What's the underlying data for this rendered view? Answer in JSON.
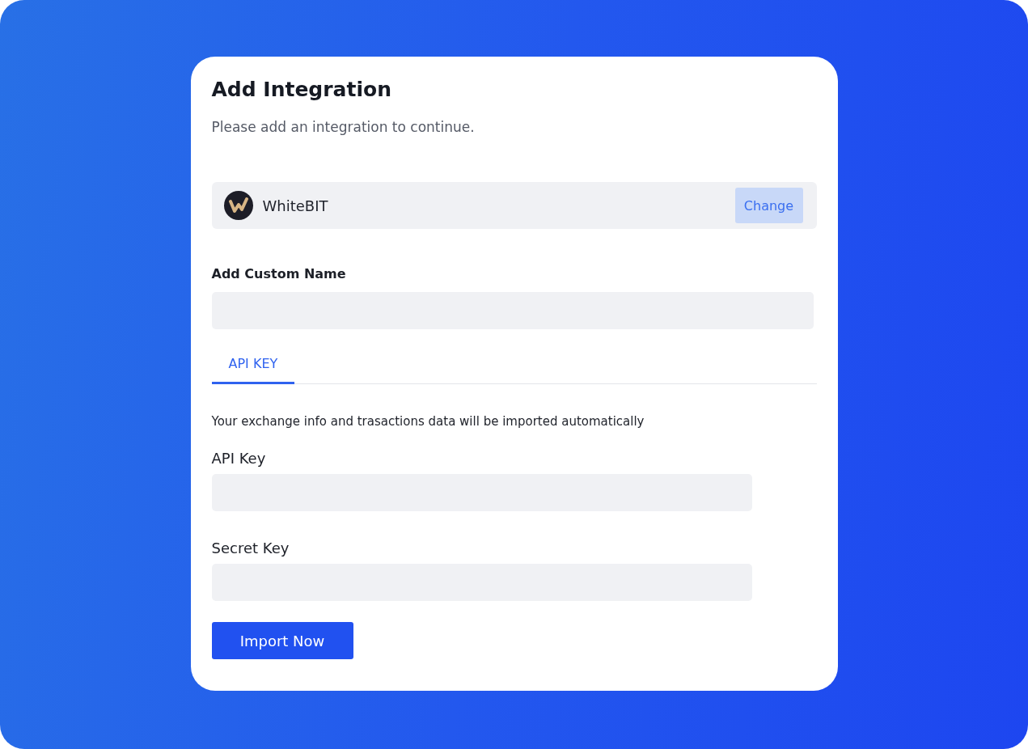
{
  "dialog": {
    "title": "Add Integration",
    "subtitle": "Please add an integration to continue."
  },
  "provider": {
    "name": "WhiteBIT",
    "action": "Change"
  },
  "custom_name": {
    "label": "Add Custom Name"
  },
  "tabs": [
    {
      "label": "API KEY",
      "selected": true
    }
  ],
  "description": "Your exchange info and trasactions data will be imported automatically",
  "fields": [
    {
      "label": "API Key"
    },
    {
      "label": "Secret Key"
    }
  ],
  "submit": "Import Now"
}
